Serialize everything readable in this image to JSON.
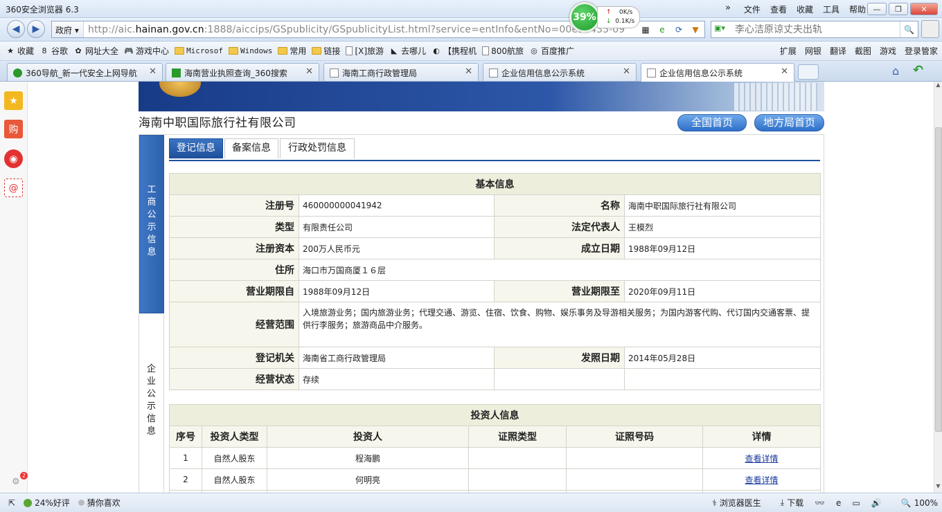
{
  "window": {
    "title": "360安全浏览器 6.3",
    "menu": [
      "文件",
      "查看",
      "收藏",
      "工具",
      "帮助"
    ]
  },
  "speed": {
    "percent": "39%",
    "up": "0K/s",
    "down": "0.1K/s"
  },
  "address": {
    "zone": "政府",
    "url_prefix": "http://aic.",
    "url_domain": "hainan.gov.cn",
    "url_rest": ":1888/aiccips/GSpublicity/GSpublicityList.html?service=entInfo&entNo=00e95435-09",
    "search_placeholder": "李心洁原谅丈夫出轨"
  },
  "favorites": [
    {
      "label": "收藏",
      "icon": "star-icon"
    },
    {
      "label": "谷歌",
      "icon": "google-icon"
    },
    {
      "label": "网址大全",
      "icon": "globe-icon"
    },
    {
      "label": "游戏中心",
      "icon": "gamepad-icon"
    },
    {
      "label": "Microsof",
      "icon": "folder-icon",
      "mono": true
    },
    {
      "label": "Windows",
      "icon": "folder-icon",
      "mono": true
    },
    {
      "label": "常用",
      "icon": "folder-icon"
    },
    {
      "label": "链接",
      "icon": "folder-icon"
    },
    {
      "label": "[X]旅游",
      "icon": "page-icon"
    },
    {
      "label": "去哪儿",
      "icon": "qunar-icon"
    },
    {
      "label": "【携程机",
      "icon": "ctrip-icon"
    },
    {
      "label": "800航旅",
      "icon": "page-icon"
    },
    {
      "label": "百度推广",
      "icon": "baidu-icon"
    }
  ],
  "favorites_right": [
    "扩展",
    "网银",
    "翻译",
    "截图",
    "游戏",
    "登录管家"
  ],
  "tabs": [
    {
      "label": "360导航_新一代安全上网导航"
    },
    {
      "label": "海南营业执照查询_360搜索"
    },
    {
      "label": "海南工商行政管理局"
    },
    {
      "label": "企业信用信息公示系统"
    },
    {
      "label": "企业信用信息公示系统"
    }
  ],
  "page": {
    "company": "海南中职国际旅行社有限公司",
    "btn_national": "全国首页",
    "btn_local": "地方局首页",
    "vtab1": "工商公示信息",
    "vtab2": "企业公示信息",
    "subtabs": [
      "登记信息",
      "备案信息",
      "行政处罚信息"
    ],
    "basic": {
      "caption": "基本信息",
      "reg_no_label": "注册号",
      "reg_no": "460000000041942",
      "name_label": "名称",
      "name": "海南中职国际旅行社有限公司",
      "type_label": "类型",
      "type": "有限责任公司",
      "rep_label": "法定代表人",
      "rep": "王模烈",
      "capital_label": "注册资本",
      "capital": "200万人民币元",
      "founded_label": "成立日期",
      "founded": "1988年09月12日",
      "address_label": "住所",
      "address": "海口市万国商厦１６层",
      "term_from_label": "营业期限自",
      "term_from": "1988年09月12日",
      "term_to_label": "营业期限至",
      "term_to": "2020年09月11日",
      "scope_label": "经营范围",
      "scope": "入境旅游业务；国内旅游业务；代理交通、游览、住宿、饮食、购物、娱乐事务及导游相关服务；为国内游客代购、代订国内交通客票、提供行李服务；旅游商品中介服务。",
      "authority_label": "登记机关",
      "authority": "海南省工商行政管理局",
      "issue_label": "发照日期",
      "issue": "2014年05月28日",
      "status_label": "经营状态",
      "status": "存续"
    },
    "investors": {
      "caption": "投资人信息",
      "headers": [
        "序号",
        "投资人类型",
        "投资人",
        "证照类型",
        "证照号码",
        "详情"
      ],
      "rows": [
        {
          "no": "1",
          "type": "自然人股东",
          "name": "程海鹏",
          "id_type": "",
          "id_no": "",
          "detail": "查看详情"
        },
        {
          "no": "2",
          "type": "自然人股东",
          "name": "何明亮",
          "id_type": "",
          "id_no": "",
          "detail": "查看详情"
        }
      ]
    }
  },
  "status": {
    "rating": "24%好评",
    "guess": "猜你喜欢",
    "doctor": "浏览器医生",
    "download": "下载",
    "zoom": "100%",
    "badge": "2"
  }
}
